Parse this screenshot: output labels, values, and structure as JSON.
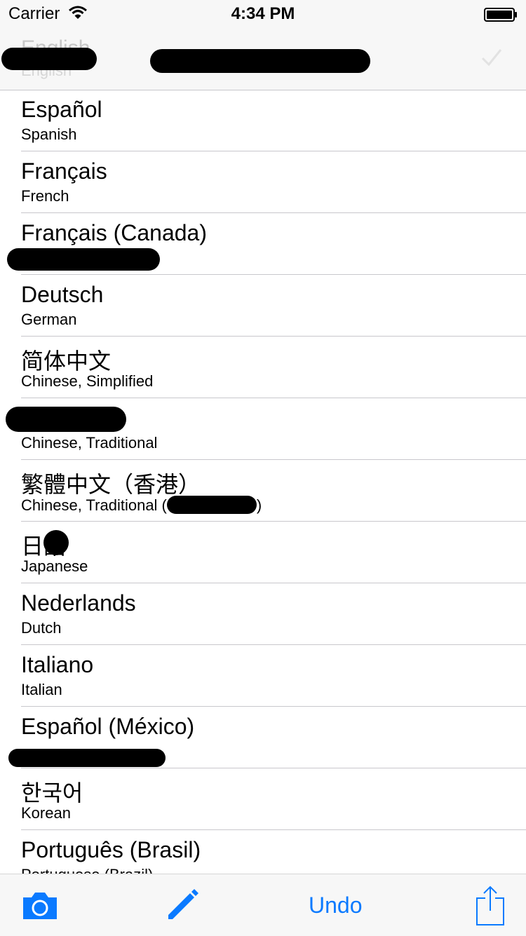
{
  "status_bar": {
    "carrier": "Carrier",
    "time": "4:34 PM"
  },
  "header": {
    "faded_primary": "English",
    "faded_secondary": "English"
  },
  "languages": [
    {
      "primary": "Español",
      "secondary": "Spanish"
    },
    {
      "primary": "Français",
      "secondary": "French"
    },
    {
      "primary": "Français (Canada)",
      "secondary": ""
    },
    {
      "primary": "Deutsch",
      "secondary": "German"
    },
    {
      "primary": "简体中文",
      "secondary": "Chinese, Simplified"
    },
    {
      "primary": "",
      "secondary": "Chinese, Traditional"
    },
    {
      "primary": "繁體中文（香港）",
      "secondary": "Chinese, Traditional ("
    },
    {
      "primary": "日語",
      "secondary": "Japanese"
    },
    {
      "primary": "Nederlands",
      "secondary": "Dutch"
    },
    {
      "primary": "Italiano",
      "secondary": "Italian"
    },
    {
      "primary": "Español (México)",
      "secondary": ""
    },
    {
      "primary": "한국어",
      "secondary": "Korean"
    },
    {
      "primary": "Português (Brasil)",
      "secondary": "Portuguese (Brazil)"
    }
  ],
  "toolbar": {
    "undo_label": "Undo"
  },
  "icons": {
    "wifi": "wifi-icon",
    "battery": "battery-icon",
    "check": "checkmark-icon",
    "camera": "camera-icon",
    "edit": "pencil-icon",
    "share": "share-icon"
  },
  "colors": {
    "accent": "#0a7aff",
    "bar_background": "#f7f7f7",
    "separator": "#c8c7cc"
  }
}
